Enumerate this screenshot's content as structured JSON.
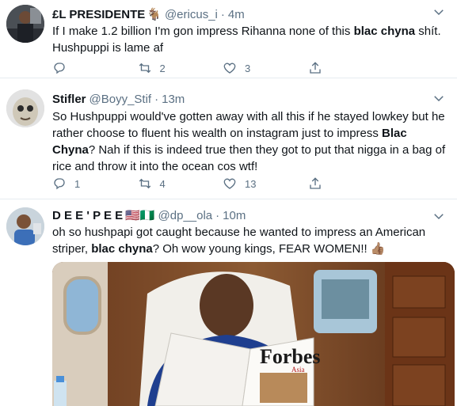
{
  "tweets": [
    {
      "name": "£L PRESIDENTE",
      "name_emoji": "🐐",
      "handle": "@ericus_i",
      "time": "4m",
      "text_parts": [
        "If I make 1.2 billion I'm gon impress Rihanna none of this ",
        "blac chyna",
        " shít. Hushpuppi is lame af"
      ],
      "retweets": "2",
      "likes": "3"
    },
    {
      "name": "Stifler",
      "handle": "@Boyy_Stif",
      "time": "13m",
      "text_parts": [
        "So Hushpuppi would've gotten away with all this if he stayed lowkey but he rather choose to fluent his wealth on instagram just to impress ",
        "Blac Chyna",
        "? Nah if this is indeed true then they got to put that nigga in a bag of rice and throw it into the ocean cos wtf!"
      ],
      "replies": "1",
      "retweets": "4",
      "likes": "13"
    },
    {
      "name": "D E E ' P E E",
      "name_emoji": "🇺🇸🇳🇬",
      "handle": "@dp__ola",
      "time": "10m",
      "text_parts": [
        "oh so hushpapi got caught because he wanted to impress an American striper, ",
        "blac chyna",
        "? Oh wow young kings, FEAR WOMEN!! ",
        "👍🏽"
      ],
      "media": {
        "magazine_title": "Forbes",
        "magazine_subtitle": "Asia"
      }
    }
  ],
  "separator": "·",
  "colors": {
    "secondary_text": "#5b7083",
    "primary_text": "#0f1419",
    "divider": "#e6ecf0"
  }
}
